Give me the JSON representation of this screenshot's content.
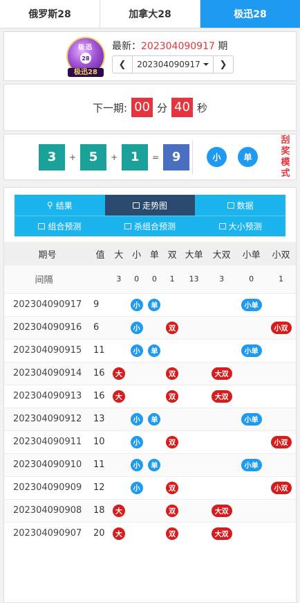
{
  "tabs": [
    {
      "label": "俄罗斯28",
      "active": false
    },
    {
      "label": "加拿大28",
      "active": false
    },
    {
      "label": "极迅28",
      "active": true
    }
  ],
  "logo": {
    "top": "极迅",
    "ball": "28",
    "label": "极迅28"
  },
  "latest": {
    "prefix": "最新：",
    "period": "202304090917",
    "suffix": " 期",
    "select_value": "202304090917"
  },
  "countdown": {
    "label": "下一期:",
    "minutes": "00",
    "min_unit": "分",
    "seconds": "40",
    "sec_unit": "秒"
  },
  "result": {
    "n1": "3",
    "n2": "5",
    "n3": "1",
    "plus": "+",
    "eq": "=",
    "sum": "9",
    "tag1": "小",
    "tag2": "单",
    "scratch": "刮奖模式"
  },
  "nav": {
    "row1": [
      {
        "label": "结果",
        "icon": "key-icon"
      },
      {
        "label": "走势图",
        "icon": "chart-icon",
        "active": true
      },
      {
        "label": "数据",
        "icon": "chart-icon"
      }
    ],
    "row2": [
      {
        "label": "组合预测",
        "icon": "chart-icon"
      },
      {
        "label": "杀组合预测",
        "icon": "chart-icon"
      },
      {
        "label": "大小预测",
        "icon": "chart-icon"
      }
    ]
  },
  "table": {
    "headers": [
      "期号",
      "值",
      "大",
      "小",
      "单",
      "双",
      "大单",
      "大双",
      "小单",
      "小双"
    ],
    "gap_label": "间隔",
    "gaps": [
      "3",
      "0",
      "0",
      "1",
      "13",
      "3",
      "0",
      "1"
    ],
    "rows": [
      {
        "period": "202304090917",
        "val": "9",
        "cells": [
          "",
          "小",
          "单",
          "",
          "",
          "",
          "小单",
          ""
        ]
      },
      {
        "period": "202304090916",
        "val": "6",
        "cells": [
          "",
          "小",
          "",
          "双",
          "",
          "",
          "",
          "小双"
        ]
      },
      {
        "period": "202304090915",
        "val": "11",
        "cells": [
          "",
          "小",
          "单",
          "",
          "",
          "",
          "小单",
          ""
        ]
      },
      {
        "period": "202304090914",
        "val": "16",
        "cells": [
          "大",
          "",
          "",
          "双",
          "",
          "大双",
          "",
          ""
        ]
      },
      {
        "period": "202304090913",
        "val": "16",
        "cells": [
          "大",
          "",
          "",
          "双",
          "",
          "大双",
          "",
          ""
        ]
      },
      {
        "period": "202304090912",
        "val": "13",
        "cells": [
          "",
          "小",
          "单",
          "",
          "",
          "",
          "小单",
          ""
        ]
      },
      {
        "period": "202304090911",
        "val": "10",
        "cells": [
          "",
          "小",
          "",
          "双",
          "",
          "",
          "",
          "小双"
        ]
      },
      {
        "period": "202304090910",
        "val": "11",
        "cells": [
          "",
          "小",
          "单",
          "",
          "",
          "",
          "小单",
          ""
        ]
      },
      {
        "period": "202304090909",
        "val": "12",
        "cells": [
          "",
          "小",
          "",
          "双",
          "",
          "",
          "",
          "小双"
        ]
      },
      {
        "period": "202304090908",
        "val": "18",
        "cells": [
          "大",
          "",
          "",
          "双",
          "",
          "大双",
          "",
          ""
        ]
      },
      {
        "period": "202304090907",
        "val": "20",
        "cells": [
          "大",
          "",
          "",
          "双",
          "",
          "大双",
          "",
          ""
        ]
      }
    ]
  },
  "colors": {
    "accent": "#1e9bf0",
    "red": "#d51d1d",
    "teal": "#1aa19a",
    "sum": "#4a6fc1",
    "dark": "#2b4a6f"
  }
}
